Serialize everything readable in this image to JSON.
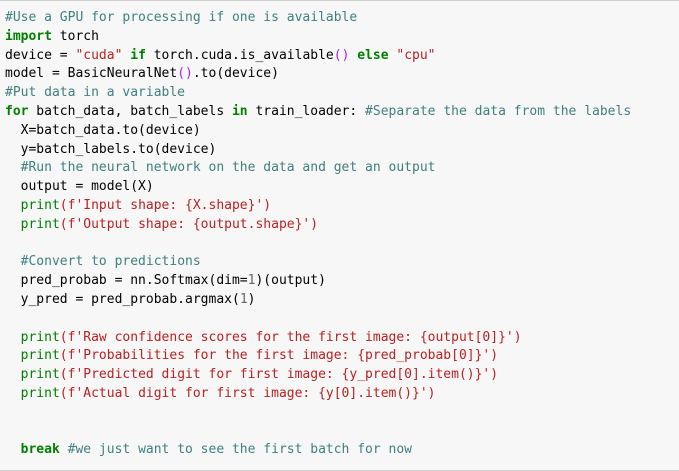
{
  "code_cell": {
    "lines": [
      [
        {
          "t": "#Use a GPU for processing if one is available",
          "c": "cm"
        }
      ],
      [
        {
          "t": "import",
          "c": "kw"
        },
        {
          "t": " torch",
          "c": ""
        }
      ],
      [
        {
          "t": "device = ",
          "c": ""
        },
        {
          "t": "\"cuda\"",
          "c": "st"
        },
        {
          "t": " if ",
          "c": "kw"
        },
        {
          "t": "torch.cuda.is_available",
          "c": ""
        },
        {
          "t": "()",
          "c": "op"
        },
        {
          "t": " else ",
          "c": "kw"
        },
        {
          "t": "\"cpu\"",
          "c": "st"
        }
      ],
      [
        {
          "t": "model = BasicNeuralNet",
          "c": ""
        },
        {
          "t": "()",
          "c": "op"
        },
        {
          "t": ".to(device)",
          "c": ""
        }
      ],
      [
        {
          "t": "#Put data in a variable",
          "c": "cm"
        }
      ],
      [
        {
          "t": "for",
          "c": "kw"
        },
        {
          "t": " batch_data, batch_labels ",
          "c": ""
        },
        {
          "t": "in",
          "c": "kw"
        },
        {
          "t": " train_loader: ",
          "c": ""
        },
        {
          "t": "#Separate the data from the labels",
          "c": "cm"
        }
      ],
      [
        {
          "t": "  X=batch_data.to(device)",
          "c": ""
        }
      ],
      [
        {
          "t": "  y=batch_labels.to(device)",
          "c": ""
        }
      ],
      [
        {
          "t": "  ",
          "c": ""
        },
        {
          "t": "#Run the neural network on the data and get an output",
          "c": "cm"
        }
      ],
      [
        {
          "t": "  output = model(X)",
          "c": ""
        }
      ],
      [
        {
          "t": "  ",
          "c": ""
        },
        {
          "t": "print",
          "c": "bi"
        },
        {
          "t": "(f'Input shape: {X.shape}')",
          "c": "st"
        }
      ],
      [
        {
          "t": "  ",
          "c": ""
        },
        {
          "t": "print",
          "c": "bi"
        },
        {
          "t": "(f'Output shape: {output.shape}')",
          "c": "st"
        }
      ],
      [
        {
          "t": "",
          "c": ""
        }
      ],
      [
        {
          "t": "  ",
          "c": ""
        },
        {
          "t": "#Convert to predictions",
          "c": "cm"
        }
      ],
      [
        {
          "t": "  pred_probab = nn.Softmax(dim=",
          "c": ""
        },
        {
          "t": "1",
          "c": "num"
        },
        {
          "t": ")(output)",
          "c": ""
        }
      ],
      [
        {
          "t": "  y_pred = pred_probab.argmax(",
          "c": ""
        },
        {
          "t": "1",
          "c": "num"
        },
        {
          "t": ")",
          "c": ""
        }
      ],
      [
        {
          "t": "",
          "c": ""
        }
      ],
      [
        {
          "t": "  ",
          "c": ""
        },
        {
          "t": "print",
          "c": "bi"
        },
        {
          "t": "(f'Raw confidence scores for the first image: {output[0]}')",
          "c": "st"
        }
      ],
      [
        {
          "t": "  ",
          "c": ""
        },
        {
          "t": "print",
          "c": "bi"
        },
        {
          "t": "(f'Probabilities for the first image: {pred_probab[0]}')",
          "c": "st"
        }
      ],
      [
        {
          "t": "  ",
          "c": ""
        },
        {
          "t": "print",
          "c": "bi"
        },
        {
          "t": "(f'Predicted digit for first image: {y_pred[0].item()}')",
          "c": "st"
        }
      ],
      [
        {
          "t": "  ",
          "c": ""
        },
        {
          "t": "print",
          "c": "bi"
        },
        {
          "t": "(f'Actual digit for first image: {y[0].item()}')",
          "c": "st"
        }
      ],
      [
        {
          "t": "",
          "c": ""
        }
      ],
      [
        {
          "t": "",
          "c": ""
        }
      ],
      [
        {
          "t": "  ",
          "c": ""
        },
        {
          "t": "break",
          "c": "kw"
        },
        {
          "t": " ",
          "c": ""
        },
        {
          "t": "#we just want to see the first batch for now",
          "c": "cm"
        }
      ]
    ]
  },
  "colors": {
    "background": "#f7f7f7",
    "comment": "#408080",
    "keyword": "#008000",
    "string": "#ba2121",
    "number": "#666666",
    "operator": "#aa22ff"
  }
}
